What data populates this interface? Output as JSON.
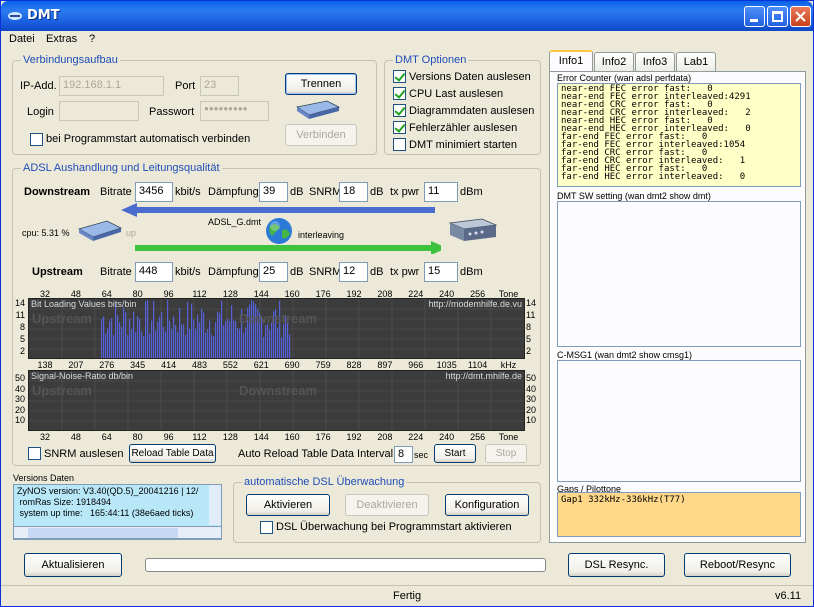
{
  "window": {
    "title": "DMT"
  },
  "menu": [
    "Datei",
    "Extras",
    "?"
  ],
  "conn": {
    "group": "Verbindungsaufbau",
    "ip_label": "IP-Add.",
    "ip_value": "192.168.1.1",
    "port_label": "Port",
    "port_value": "23",
    "login_label": "Login",
    "login_value": "",
    "pass_label": "Passwort",
    "pass_value": "●●●●●●●●●",
    "trennen": "Trennen",
    "verbinden": "Verbinden",
    "autoconnect": "bei Programmstart automatisch verbinden"
  },
  "options": {
    "group": "DMT Optionen",
    "items": [
      {
        "label": "Versions Daten auslesen",
        "checked": true
      },
      {
        "label": "CPU Last auslesen",
        "checked": true
      },
      {
        "label": "Diagrammdaten auslesen",
        "checked": true
      },
      {
        "label": "Fehlerzähler auslesen",
        "checked": true
      },
      {
        "label": "DMT minimiert starten",
        "checked": false
      }
    ]
  },
  "adsl": {
    "group": "ADSL Aushandlung und Leitungsqualität",
    "downstream": {
      "title": "Downstream",
      "bitrate_label": "Bitrate",
      "bitrate": "3456",
      "bitrate_unit": "kbit/s",
      "damp_label": "Dämpfung",
      "damp": "39",
      "damp_unit": "dB",
      "snrm_label": "SNRM",
      "snrm": "18",
      "snrm_unit": "dB",
      "txpwr_label": "tx pwr",
      "txpwr": "11",
      "txpwr_unit": "dBm"
    },
    "upstream": {
      "title": "Upstream",
      "bitrate_label": "Bitrate",
      "bitrate": "448",
      "bitrate_unit": "kbit/s",
      "damp_label": "Dämpfung",
      "damp": "25",
      "damp_unit": "dB",
      "snrm_label": "SNRM",
      "snrm": "12",
      "snrm_unit": "dB",
      "txpwr_label": "tx pwr",
      "txpwr": "15",
      "txpwr_unit": "dBm"
    },
    "cpu": "cpu: 5.31 %",
    "up": "up",
    "mode": "ADSL_G.dmt",
    "interleave": "interleaving"
  },
  "chart1": {
    "title": "Bit Loading Values  bits/bin",
    "url": "http://modemhilfe.de.vu",
    "wm_left": "Upstream",
    "wm_right": "Downstream",
    "top_ticks": [
      "32",
      "48",
      "64",
      "80",
      "96",
      "112",
      "128",
      "144",
      "160",
      "176",
      "192",
      "208",
      "224",
      "240",
      "256",
      "Tone"
    ],
    "y_ticks": [
      "14",
      "11",
      "8",
      "5",
      "2"
    ],
    "bottom_ticks": [
      "138",
      "207",
      "276",
      "345",
      "414",
      "483",
      "552",
      "621",
      "690",
      "759",
      "828",
      "897",
      "966",
      "1035",
      "1104",
      "kHz"
    ]
  },
  "chart2": {
    "title": "Signal-Noise-Ratio  db/bin",
    "url": "http://dmt.mhilfe.de",
    "wm_left": "Upstream",
    "wm_right": "Downstream",
    "y_ticks": [
      "50",
      "40",
      "30",
      "20",
      "10"
    ],
    "bottom_ticks": [
      "32",
      "48",
      "64",
      "80",
      "96",
      "112",
      "128",
      "144",
      "160",
      "176",
      "192",
      "208",
      "224",
      "240",
      "256",
      "Tone"
    ]
  },
  "chart_data": {
    "type": "bar",
    "title": "Bit Loading Values",
    "ylabel": "bits/bin",
    "ylim": [
      0,
      15
    ],
    "xlim": [
      32,
      256
    ],
    "note": "bars drawn for tones ~64-146"
  },
  "controls": {
    "snrm": "SNRM auslesen",
    "reload": "Reload Table Data",
    "interval_label": "Auto Reload Table Data Interval:",
    "interval": "8",
    "sec": "sec",
    "start": "Start",
    "stop": "Stop"
  },
  "versions": {
    "label": "Versions Daten",
    "lines": "ZyNOS version: V3.40(QD.5)_20041216 | 12/\n romRas Size: 1918494\n system up time:   165:44:11 (38e6aed ticks)"
  },
  "watch": {
    "group": "automatische DSL Überwachung",
    "activate": "Aktivieren",
    "deactivate": "Deaktivieren",
    "config": "Konfiguration",
    "auto": "DSL Überwachung bei Programmstart aktivieren"
  },
  "tabs": [
    "Info1",
    "Info2",
    "Info3",
    "Lab1"
  ],
  "info": {
    "err_label": "Error Counter (wan adsl perfdata)",
    "err_text": "near-end FEC error fast:   0\nnear-end FEC error interleaved:4291\nnear-end CRC error fast:   0\nnear-end CRC error interleaved:   2\nnear-end HEC error fast:   0\nnear-end HEC error interleaved:   0\nfar-end FEC error fast:   0\nfar-end FEC error interleaved:1054\nfar-end CRC error fast:   0\nfar-end CRC error interleaved:   1\nfar-end HEC error fast:   0\nfar-end HEC error interleaved:   0",
    "sw_label": "DMT SW setting (wan dmt2 show dmt)",
    "cmsg_label": "C-MSG1 (wan dmt2 show cmsg1)",
    "gaps_label": "Gaps / Pilottone",
    "gaps_text": "Gap1 332kHz-336kHz(T77)"
  },
  "bottom": {
    "refresh": "Aktualisieren",
    "resync": "DSL Resync.",
    "reboot": "Reboot/Resync"
  },
  "status": {
    "text": "Fertig",
    "version": "v6.11"
  },
  "colors": {
    "arrow_down": "#4a6ccf",
    "arrow_up": "#3dc23d",
    "bars": "#5660d8"
  }
}
